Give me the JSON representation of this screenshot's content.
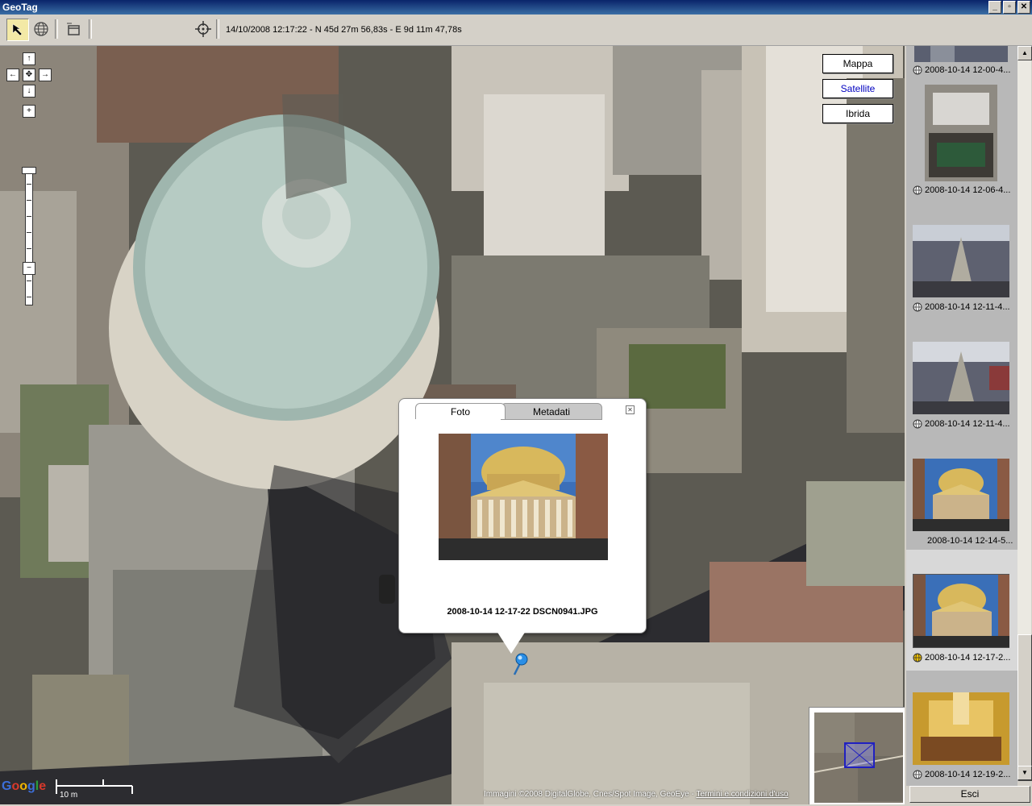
{
  "window": {
    "title": "GeoTag",
    "controls": [
      "_",
      "▫",
      "✕"
    ]
  },
  "toolbar": {
    "coordinates": "14/10/2008 12:17:22 - N 45d 27m 56,83s - E 9d 11m 47,78s"
  },
  "map": {
    "type_buttons": [
      "Mappa",
      "Satellite",
      "Ibrida"
    ],
    "selected_type": "Satellite",
    "copyright_prefix": "Immagini ©2008 DigitalGlobe, Cnes/Spot Image, GeoEye - ",
    "copyright_terms": "Termini e condizioni d'uso",
    "scale_label": "10 m",
    "logo_text": "Google"
  },
  "infowindow": {
    "tabs": [
      "Foto",
      "Metadati"
    ],
    "active_tab": "Foto",
    "caption": "2008-10-14 12-17-22 DSCN0941.JPG"
  },
  "thumbnails": [
    {
      "label": "2008-10-14 12-00-4...",
      "geotagged": true
    },
    {
      "label": "2008-10-14 12-06-4...",
      "geotagged": true
    },
    {
      "label": "2008-10-14 12-11-4...",
      "geotagged": true
    },
    {
      "label": "2008-10-14 12-11-4...",
      "geotagged": true
    },
    {
      "label": "2008-10-14 12-14-5...",
      "geotagged": false
    },
    {
      "label": "2008-10-14 12-17-2...",
      "geotagged": true,
      "selected": true
    },
    {
      "label": "2008-10-14 12-19-2...",
      "geotagged": true
    }
  ],
  "exit_button": "Esci"
}
